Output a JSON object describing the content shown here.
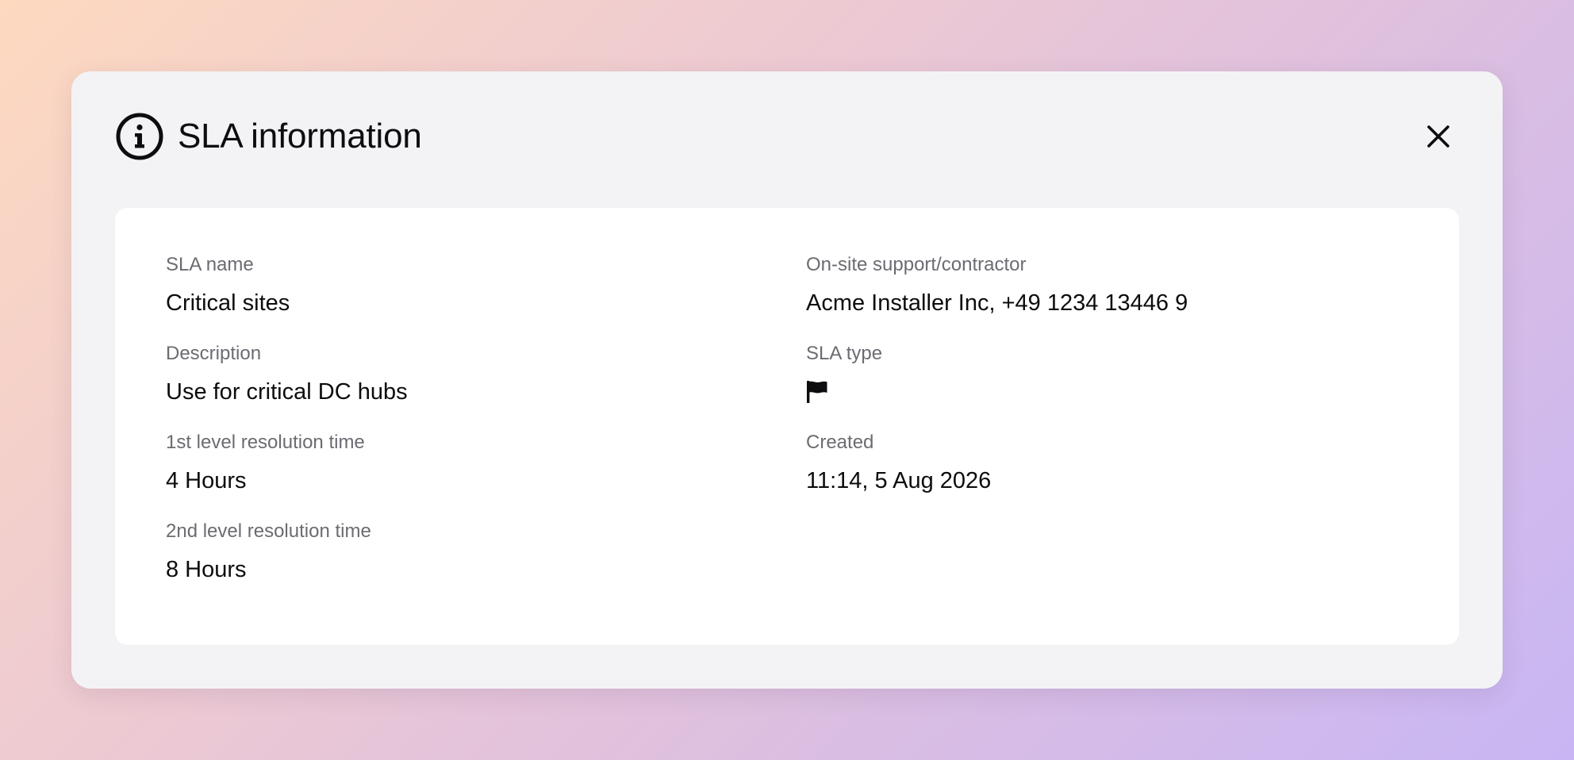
{
  "modal": {
    "title": "SLA information",
    "info_icon": "info-circle-icon",
    "close_icon": "close-icon"
  },
  "details": {
    "left": [
      {
        "label": "SLA name",
        "value": "Critical sites"
      },
      {
        "label": "Description",
        "value": "Use for critical DC hubs"
      },
      {
        "label": "1st level resolution time",
        "value": "4 Hours"
      },
      {
        "label": "2nd level resolution time",
        "value": "8 Hours"
      }
    ],
    "right": [
      {
        "label": "On-site support/contractor",
        "value": "Acme Installer Inc, +49 1234 13446 9"
      },
      {
        "label": "SLA type",
        "icon": "flag-icon"
      },
      {
        "label": "Created",
        "value": "11:14, 5 Aug 2026"
      }
    ]
  },
  "colors": {
    "text_primary": "#0d0d10",
    "text_secondary": "#6b6b72",
    "modal_bg": "#f3f3f5",
    "card_bg": "#ffffff"
  }
}
